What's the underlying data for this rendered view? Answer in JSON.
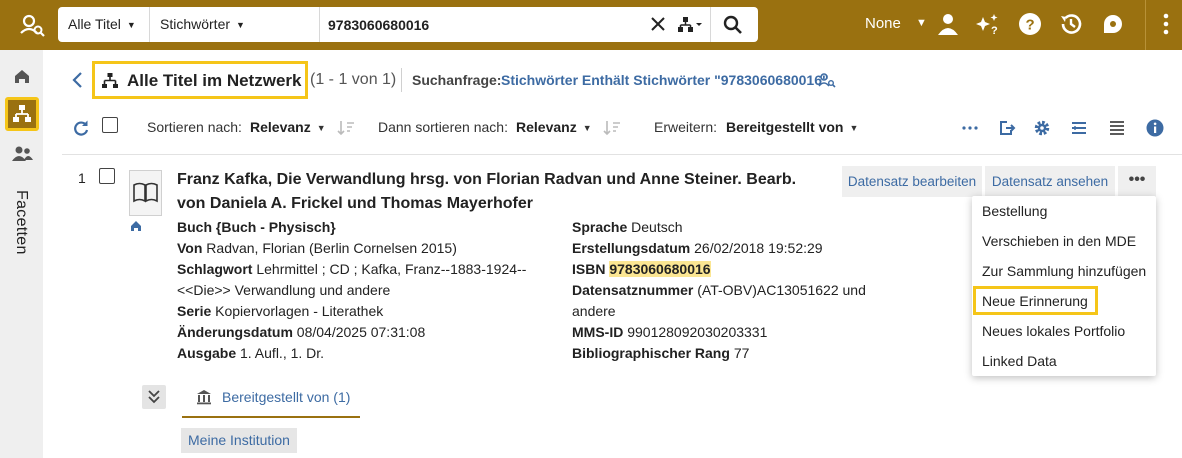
{
  "topbar": {
    "logo_icon": "search-person-icon",
    "search": {
      "scope": "Alle Titel",
      "field": "Stichwörter",
      "query": "9783060680016"
    },
    "profile_label": "None",
    "icons": [
      "user-icon",
      "sparkle-help-icon",
      "help-icon",
      "history-icon",
      "chat-bubble-icon",
      "kebab-icon"
    ]
  },
  "rail": {
    "items": [
      "home-icon",
      "network-icon",
      "people-icon"
    ],
    "facets_label": "Facetten"
  },
  "header": {
    "title": "Alle Titel im Netzwerk",
    "count": "(1 - 1 von 1)",
    "query_label": "Suchanfrage:",
    "query_text": "Stichwörter Enthält Stichwörter \"9783060680016\""
  },
  "toolbar": {
    "sort_label": "Sortieren nach:",
    "sort_value": "Relevanz",
    "then_sort_label": "Dann sortieren nach:",
    "then_sort_value": "Relevanz",
    "expand_label": "Erweitern:",
    "expand_value": "Bereitgestellt von"
  },
  "record": {
    "number": "1",
    "title": "Franz Kafka, Die Verwandlung hrsg. von Florian Radvan und Anne Steiner. Bearb. von Daniela A. Frickel und Thomas Mayerhofer",
    "type": "Buch {Buch - Physisch}",
    "left_fields": [
      {
        "label": "Von",
        "value": "Radvan, Florian (Berlin Cornelsen 2015)"
      },
      {
        "label": "Schlagwort",
        "value": "Lehrmittel ; CD ; Kafka, Franz--1883-1924--"
      },
      {
        "label": "",
        "value": "<<Die>> Verwandlung und andere"
      },
      {
        "label": "Serie",
        "value": "Kopiervorlagen - Literathek"
      },
      {
        "label": "Änderungsdatum",
        "value": "08/04/2025 07:31:08"
      },
      {
        "label": "Ausgabe",
        "value": "1. Aufl., 1. Dr."
      }
    ],
    "right_fields": [
      {
        "label": "Sprache",
        "value": "Deutsch"
      },
      {
        "label": "Erstellungsdatum",
        "value": "26/02/2018 19:52:29"
      },
      {
        "label": "ISBN",
        "value": "9783060680016"
      },
      {
        "label": "Datensatznummer",
        "value": "(AT-OBV)AC13051622 und"
      },
      {
        "label": "",
        "value": "andere"
      },
      {
        "label": "MMS-ID",
        "value": "990128092030203331"
      },
      {
        "label": "Bibliographischer Rang",
        "value": "77"
      }
    ],
    "actions": {
      "edit": "Datensatz bearbeiten",
      "view": "Datensatz ansehen",
      "more": "•••"
    },
    "menu": [
      "Bestellung",
      "Verschieben in den MDE",
      "Zur Sammlung hinzufügen",
      "Neue Erinnerung",
      "Neues lokales Portfolio",
      "Linked Data"
    ],
    "provided_tab": "Bereitgestellt von (1)",
    "institution": "Meine Institution"
  },
  "colors": {
    "brand": "#9a7110",
    "highlight": "#f5c518",
    "link": "#3d6ba3"
  }
}
